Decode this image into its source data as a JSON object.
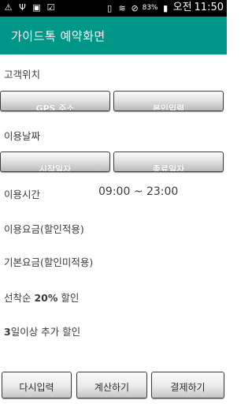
{
  "status_bar": {
    "icons_left": [
      "warning-icon",
      "usb-icon",
      "image-icon",
      "check-icon"
    ],
    "icons_right": [
      "vibrate-icon",
      "wifi-icon",
      "block-icon"
    ],
    "battery_percent": "83%",
    "battery_icon": "battery-charging-icon",
    "am_pm": "오전",
    "time": "11:50"
  },
  "action_bar": {
    "title": "가이드톡 예약화면",
    "color": "#009688"
  },
  "location": {
    "label": "고객위치",
    "gps_button": "GPS 주소",
    "manual_button": "본인입력"
  },
  "date": {
    "label": "이용날짜",
    "start_button": "시작일자",
    "end_button": "종료일자"
  },
  "time": {
    "label": "이용시간",
    "value": "09:00 ~ 23:00"
  },
  "fees": {
    "discount_applied": "이용요금(할인적용)",
    "base_fee": "기본요금(할인미적용)"
  },
  "discounts": {
    "first_come_prefix": "선착순 ",
    "first_come_percent": "20%",
    "first_come_suffix": " 할인",
    "multi_day_prefix": "3",
    "multi_day_suffix": "일이상 추가 할인"
  },
  "bottom_buttons": {
    "reset": "다시입력",
    "calculate": "계산하기",
    "pay": "결제하기"
  }
}
